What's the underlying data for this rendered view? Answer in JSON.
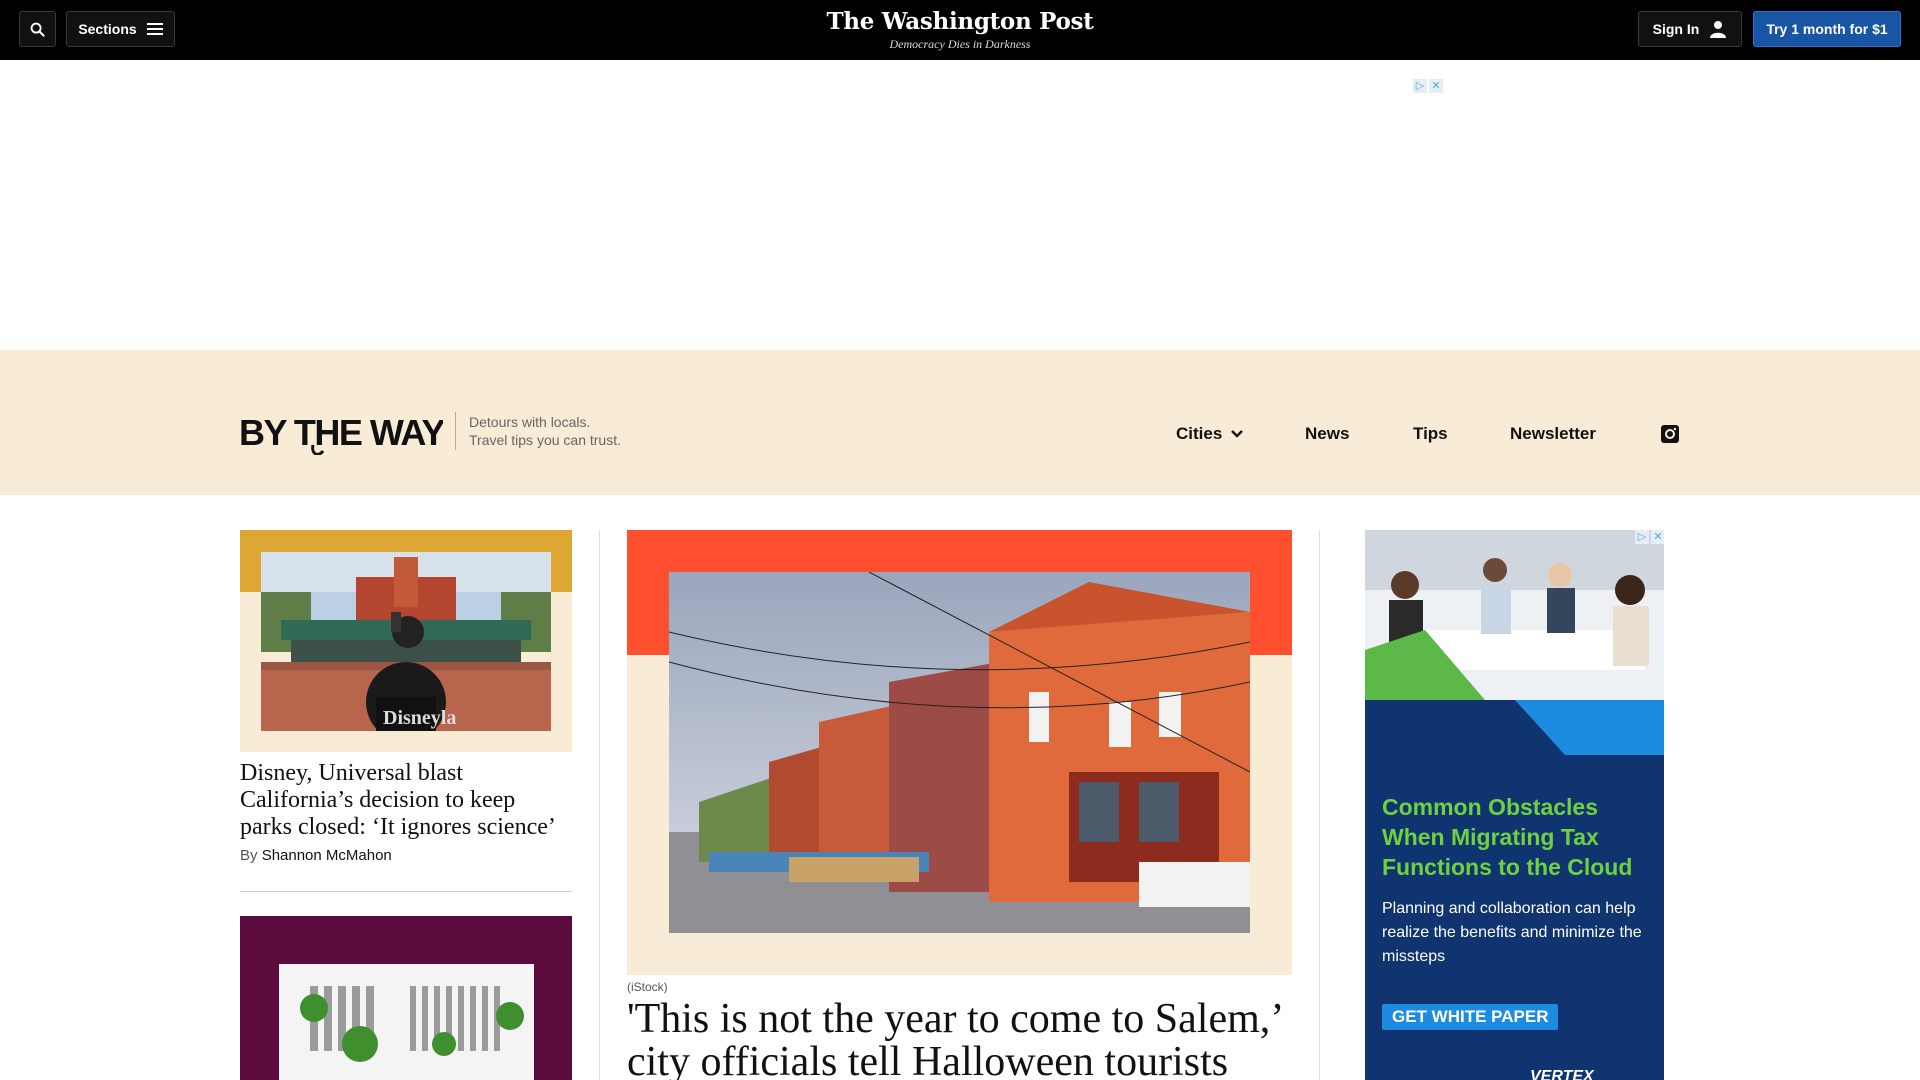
{
  "topbar": {
    "sections_label": "Sections",
    "logo": "The Washington Post",
    "tagline": "Democracy Dies in Darkness",
    "signin_label": "Sign In",
    "trial_label": "Try 1 month for $1"
  },
  "btw": {
    "logo": "BY THE WAY",
    "tagline_line1": "Detours with locals.",
    "tagline_line2": "Travel tips you can trust.",
    "nav": [
      "Cities",
      "News",
      "Tips",
      "Newsletter"
    ]
  },
  "left_story": {
    "title": "Disney, Universal blast California’s decision to keep parks closed: ‘It ignores science’",
    "by_prefix": "By",
    "author": "Shannon McMahon"
  },
  "main_story": {
    "credit": "(iStock)",
    "title": "'This is not the year to come to Salem,’ city officials tell Halloween tourists"
  },
  "side_ad": {
    "headline": "Common Obstacles When Migrating Tax Functions to the Cloud",
    "body": "Planning and collaboration can help realize the benefits and minimize the missteps",
    "cta": "GET WHITE PAPER",
    "brand": "VERTEX"
  },
  "colors": {
    "topbar": "#000000",
    "trial_button": "#1955a5",
    "btw_background": "#f8ecd6",
    "left_accent": "#dda733",
    "main_accent": "#ff4f2e",
    "ad_background": "#0f3470",
    "ad_headline": "#6fd13f"
  }
}
